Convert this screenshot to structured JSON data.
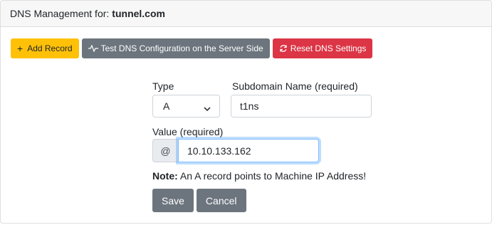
{
  "header": {
    "title_prefix": "DNS Management for:",
    "domain": "tunnel.com"
  },
  "toolbar": {
    "add_record": {
      "icon": "plus-icon",
      "label": "Add Record",
      "color": "#ffc107"
    },
    "test_dns": {
      "icon": "pulse-icon",
      "label": "Test DNS Configuration on the Server Side",
      "color": "#6c757d"
    },
    "reset_dns": {
      "icon": "refresh-icon",
      "label": "Reset DNS Settings",
      "color": "#dc3545"
    }
  },
  "form": {
    "type_label": "Type",
    "type_value": "A",
    "subdomain_label": "Subdomain Name (required)",
    "subdomain_value": "t1ns",
    "value_label": "Value (required)",
    "value_prefix": "@",
    "value_value": "10.10.133.162",
    "note_bold": "Note:",
    "note_text": " An A record points to Machine IP Address!",
    "save_label": "Save",
    "cancel_label": "Cancel"
  }
}
